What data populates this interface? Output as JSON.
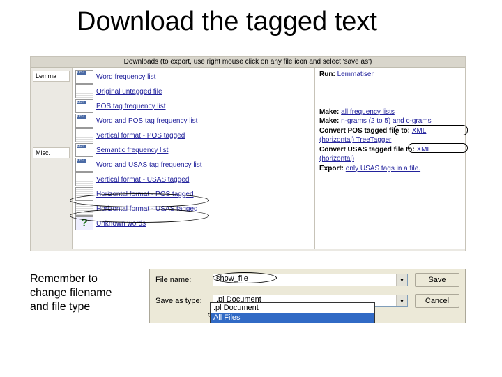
{
  "title": "Download the tagged text",
  "header": "Downloads (to export, use right mouse click on any file icon and select 'save as')",
  "leftTabs": {
    "lemma": "Lemma",
    "misc": "Misc."
  },
  "list": {
    "wfl": "Word frequency list",
    "orig": "Original untagged file",
    "posfl": "POS tag frequency list",
    "wposfl": "Word and POS tag frequency list",
    "vpos": "Vertical format - POS tagged",
    "semfl": "Semantic frequency list",
    "wusasfl": "Word and USAS tag frequency list",
    "vusas": "Vertical format - USAS tagged",
    "hpos": "Horizontal format - POS tagged",
    "husas": "Horizontal format - USAS tagged",
    "unk": "Unknown words"
  },
  "right": {
    "run_b": "Run:",
    "run_link": "Lemmatiser",
    "make1_b": "Make:",
    "make1_link": "all frequency lists",
    "make2_b": "Make:",
    "make2_link": "n-grams (2 to 5) and c-grams",
    "conv1_b": "Convert POS tagged file to:",
    "conv1_link": "XML (horizontal) TreeTagger",
    "conv2_b": "Convert USAS tagged file to:",
    "conv2_link": "XML (horizontal)",
    "exp_b": "Export:",
    "exp_link": "only USAS tags in a file."
  },
  "note": "Remember to change filename and file type",
  "dialog": {
    "fname_label": "File name:",
    "fname_value": "show_file",
    "type_label": "Save as type:",
    "type_value": ".pl Document",
    "save": "Save",
    "cancel": "Cancel",
    "opt1": ".pl Document",
    "opt2": "All Files"
  },
  "q": "?"
}
